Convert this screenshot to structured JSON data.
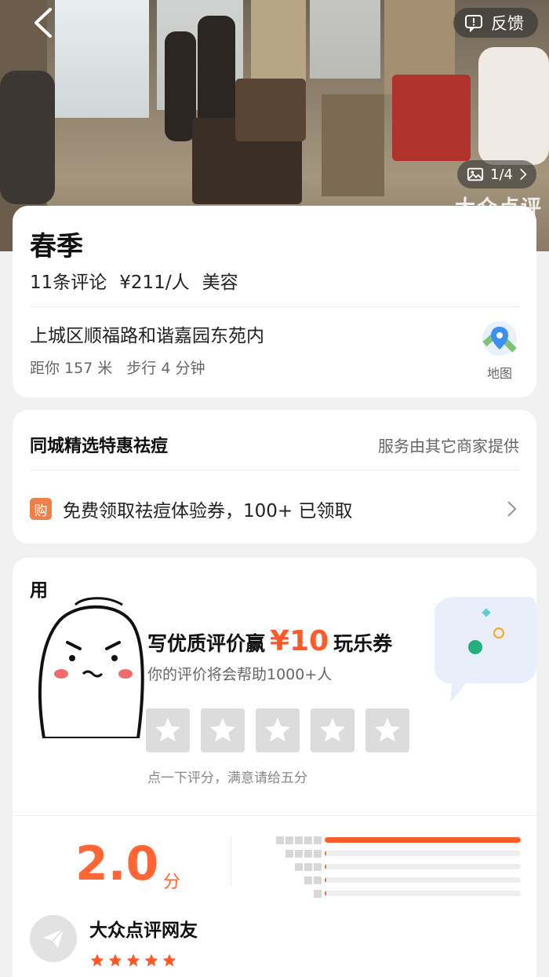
{
  "header": {
    "back_icon": "chevron-left-icon",
    "feedback_label": "反馈",
    "feedback_icon": "message-alert-icon",
    "photo_counter": "1/4",
    "photo_icon": "image-icon",
    "watermark": "大众点评"
  },
  "shop": {
    "name": "春季",
    "reviews": "11条评论",
    "price": "¥211/人",
    "category": "美容",
    "address": "上城区顺福路和谐嘉园东苑内",
    "distance": "距你 157 米",
    "walk": "步行 4 分钟",
    "map_label": "地图"
  },
  "promo": {
    "title": "同城精选特惠祛痘",
    "provider": "服务由其它商家提供",
    "badge": "购",
    "offer": "免费领取祛痘体验券，100+ 已领取"
  },
  "review_cta": {
    "heading": "用",
    "title_prefix": "写优质评价赢",
    "amount": "¥10",
    "title_suffix": "玩乐券",
    "subtitle": "你的评价将会帮助1000+人",
    "hint": "点一下评分，满意请给五分",
    "star_count": 5
  },
  "rating": {
    "score": "2.0",
    "unit": "分",
    "distribution": [
      {
        "stars": 5,
        "fraction": 1.0
      },
      {
        "stars": 4,
        "fraction": 0.0
      },
      {
        "stars": 3,
        "fraction": 0.0
      },
      {
        "stars": 2,
        "fraction": 0.0
      },
      {
        "stars": 1,
        "fraction": 0.0
      }
    ]
  },
  "reviewer": {
    "name": "大众点评网友",
    "stars": 5,
    "avatar_icon": "paper-plane-icon"
  },
  "colors": {
    "accent": "#ff5a2a",
    "star_on": "#ff5a2a",
    "star_off": "#dcdcdc"
  }
}
